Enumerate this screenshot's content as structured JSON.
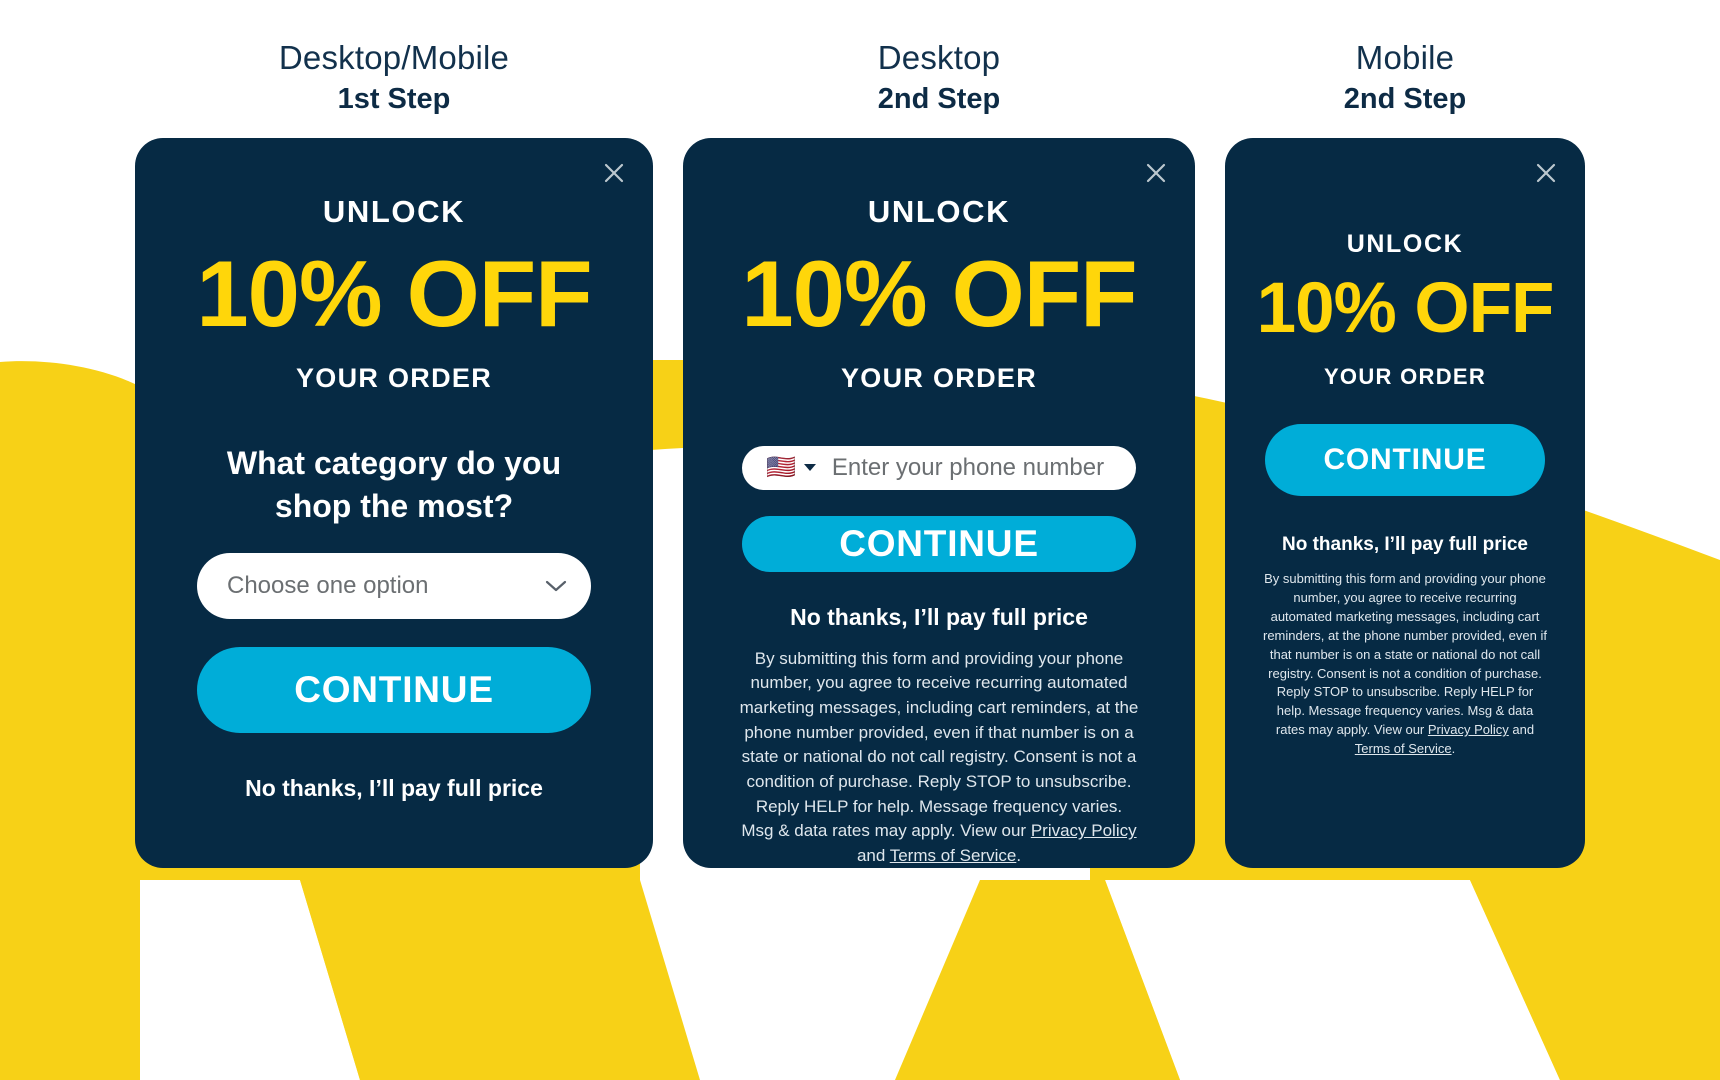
{
  "columns": [
    {
      "title_top": "Desktop/Mobile",
      "title_bottom": "1st Step",
      "card": {
        "close_icon": "close-icon",
        "unlock": "UNLOCK",
        "offer": "10% OFF",
        "your_order": "YOUR ORDER",
        "question": "What category do you shop the most?",
        "select_placeholder": "Choose one option",
        "select_icon": "chevron-down-icon",
        "continue_label": "CONTINUE",
        "decline_label": "No thanks, I’ll pay full price"
      }
    },
    {
      "title_top": "Desktop",
      "title_bottom": "2nd Step",
      "card": {
        "close_icon": "close-icon",
        "unlock": "UNLOCK",
        "offer": "10% OFF",
        "your_order": "YOUR ORDER",
        "flag_icon": "us-flag-icon",
        "country_caret_icon": "caret-down-icon",
        "phone_placeholder": "Enter your phone number",
        "continue_label": "CONTINUE",
        "decline_label": "No thanks, I’ll pay full price",
        "legal_pre": "By submitting this form and providing your phone number, you agree to receive recurring automated marketing messages, including cart reminders, at the phone number provided, even if that number is on a state or national do not call registry. Consent is not a condition of purchase. Reply STOP to unsubscribe. Reply HELP for help. Message frequency varies. Msg & data rates may apply. View our ",
        "legal_privacy": "Privacy Policy",
        "legal_mid": " and ",
        "legal_terms": "Terms of Service",
        "legal_post": "."
      }
    },
    {
      "title_top": "Mobile",
      "title_bottom": "2nd Step",
      "card": {
        "close_icon": "close-icon",
        "unlock": "UNLOCK",
        "offer": "10% OFF",
        "your_order": "YOUR ORDER",
        "continue_label": "CONTINUE",
        "decline_label": "No thanks, I’ll pay full price",
        "legal_pre": "By submitting this form and providing your phone number, you agree to receive recurring automated marketing messages, including cart reminders, at the phone number provided, even if that number is on a state or national do not call registry. Consent is not a condition of purchase. Reply STOP to unsubscribe. Reply HELP for help. Message frequency varies. Msg & data rates may apply. View our ",
        "legal_privacy": "Privacy Policy",
        "legal_mid": " and ",
        "legal_terms": "Terms of Service",
        "legal_post": "."
      }
    }
  ],
  "colors": {
    "card_bg": "#062a44",
    "accent_yellow": "#ffd60a",
    "background_yellow": "#f7d117",
    "button_cyan": "#00add8",
    "text_white": "#ffffff",
    "title_navy": "#0d2b45"
  }
}
